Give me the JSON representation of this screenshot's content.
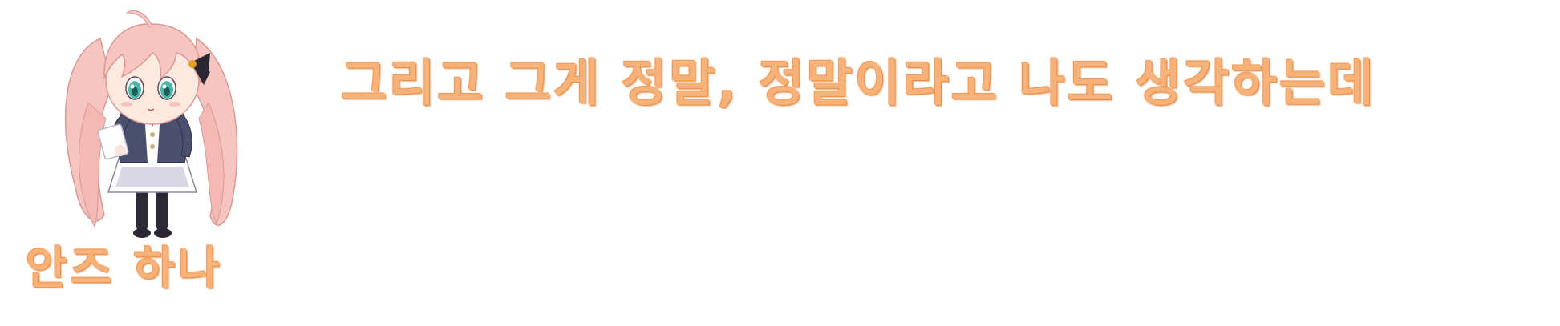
{
  "speaker": {
    "name": "안즈 하나",
    "portrait_icon": "chibi-character-portrait"
  },
  "dialogue": {
    "line": "그리고 그게 정말, 정말이라고 나도 생각하는데"
  },
  "colors": {
    "text_fill": "#f7b27a",
    "text_outline": "#e8843a",
    "background": "#ffffff",
    "hair": "#f6c5bf",
    "eyes": "#4fb6a8",
    "uniform": "#4b4f6e"
  }
}
